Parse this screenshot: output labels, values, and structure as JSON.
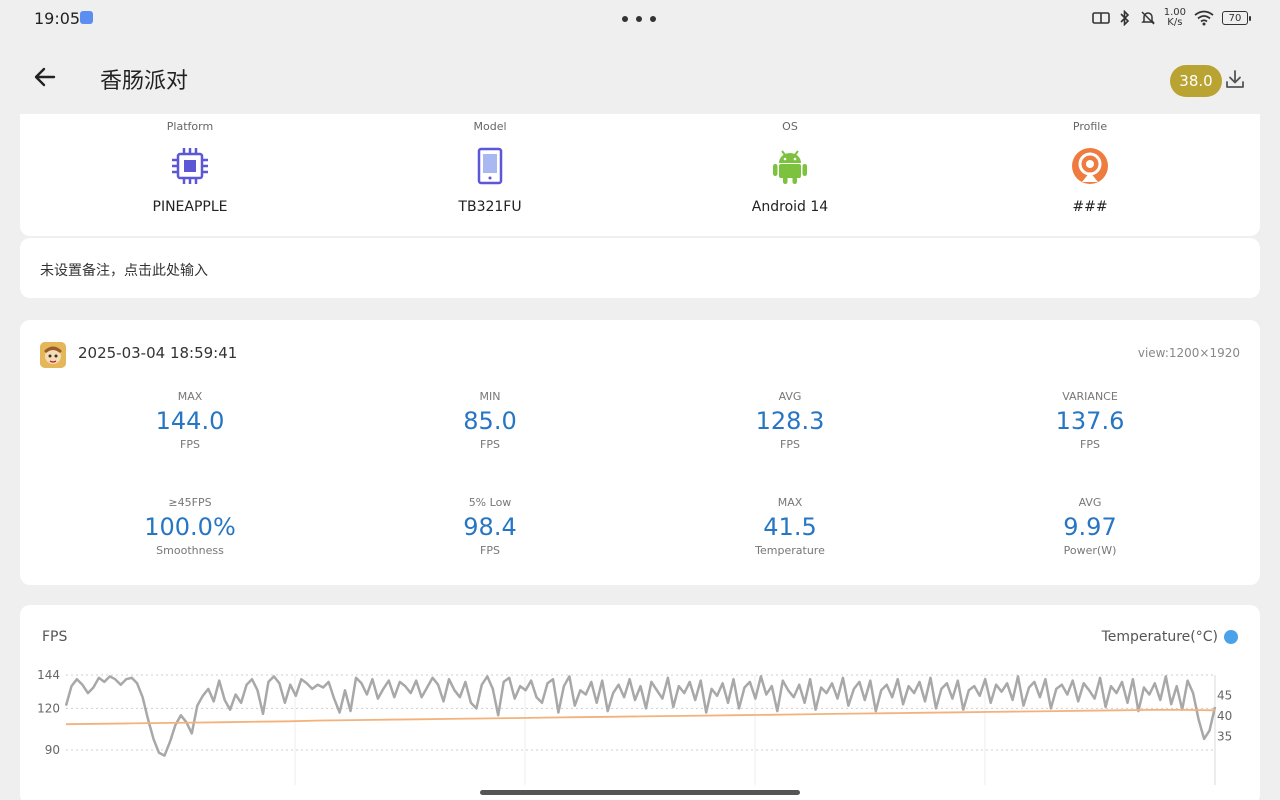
{
  "status_bar": {
    "time": "19:05",
    "net_speed_value": "1.00",
    "net_speed_unit": "K/s",
    "battery": "70"
  },
  "header": {
    "title": "香肠派对",
    "temp_badge": "38.0",
    "back_icon": "arrow-left-icon",
    "download_icon": "download-icon"
  },
  "device": [
    {
      "label": "Platform",
      "value": "PINEAPPLE",
      "icon": "chip-icon",
      "color": "#5b57d6"
    },
    {
      "label": "Model",
      "value": "TB321FU",
      "icon": "tablet-icon",
      "color": "#5b57d6"
    },
    {
      "label": "OS",
      "value": "Android 14",
      "icon": "android-icon",
      "color": "#7cc23f"
    },
    {
      "label": "Profile",
      "value": "###",
      "icon": "profile-icon",
      "color": "#f07b3f"
    }
  ],
  "note": {
    "placeholder": "未设置备注，点击此处输入"
  },
  "session": {
    "timestamp": "2025-03-04 18:59:41",
    "view": "view:1200×1920",
    "metrics": [
      {
        "label": "MAX",
        "value": "144.0",
        "unit": "FPS"
      },
      {
        "label": "MIN",
        "value": "85.0",
        "unit": "FPS"
      },
      {
        "label": "AVG",
        "value": "128.3",
        "unit": "FPS"
      },
      {
        "label": "VARIANCE",
        "value": "137.6",
        "unit": "FPS"
      },
      {
        "label": "≥45FPS",
        "value": "100.0%",
        "unit": "Smoothness"
      },
      {
        "label": "5% Low",
        "value": "98.4",
        "unit": "FPS"
      },
      {
        "label": "MAX",
        "value": "41.5",
        "unit": "Temperature"
      },
      {
        "label": "AVG",
        "value": "9.97",
        "unit": "Power(W)"
      }
    ]
  },
  "chart_data": {
    "type": "line",
    "title": "FPS",
    "legend": "Temperature(°C)",
    "left_ticks": [
      "144",
      "120",
      "90"
    ],
    "right_ticks": [
      "45",
      "40",
      "35"
    ],
    "ylim_left": [
      85,
      144
    ],
    "ylim_right": [
      30,
      50
    ],
    "series": [
      {
        "color": "#a8a8a8",
        "values": [
          122,
          136,
          141,
          137,
          131,
          135,
          142,
          139,
          143,
          141,
          137,
          141,
          142,
          138,
          128,
          112,
          98,
          88,
          86,
          96,
          108,
          115,
          110,
          102,
          122,
          129,
          134,
          125,
          140,
          126,
          119,
          130,
          124,
          137,
          141,
          133,
          116,
          139,
          143,
          138,
          124,
          137,
          129,
          141,
          138,
          134,
          137,
          135,
          139,
          127,
          117,
          133,
          118,
          142,
          138,
          130,
          141,
          127,
          134,
          140,
          128,
          139,
          136,
          131,
          140,
          128,
          135,
          142,
          137,
          125,
          141,
          133,
          128,
          139,
          124,
          120,
          137,
          143,
          134,
          115,
          139,
          142,
          127,
          136,
          133,
          140,
          128,
          124,
          138,
          141,
          117,
          136,
          143,
          122,
          133,
          130,
          139,
          124,
          140,
          118,
          131,
          137,
          128,
          141,
          126,
          136,
          120,
          139,
          133,
          127,
          142,
          121,
          136,
          131,
          139,
          126,
          140,
          117,
          134,
          129,
          138,
          124,
          141,
          120,
          135,
          139,
          127,
          143,
          130,
          136,
          118,
          140,
          133,
          128,
          137,
          124,
          141,
          119,
          135,
          131,
          138,
          127,
          142,
          122,
          134,
          139,
          126,
          140,
          118,
          133,
          137,
          128,
          141,
          123,
          136,
          131,
          139,
          125,
          142,
          120,
          134,
          138,
          127,
          140,
          119,
          133,
          136,
          129,
          141,
          124,
          137,
          132,
          138,
          126,
          143,
          122,
          135,
          139,
          128,
          141,
          120,
          134,
          137,
          130,
          140,
          125,
          138,
          133,
          127,
          142,
          121,
          136,
          131,
          139,
          124,
          141,
          118,
          135,
          130,
          138,
          126,
          143,
          123,
          136,
          119,
          140,
          131,
          112,
          98,
          104,
          121
        ]
      },
      {
        "color": "#f3b27c",
        "values": [
          38.0,
          38.1,
          38.2,
          38.3,
          38.4,
          38.5,
          38.6,
          38.7,
          38.9,
          39.0,
          39.1,
          39.2,
          39.3,
          39.4,
          39.5,
          39.6,
          39.7,
          39.8,
          39.9,
          40.0,
          40.1,
          40.2,
          40.3,
          40.4,
          40.5,
          40.6,
          40.7,
          40.8,
          40.9,
          41.0,
          41.1,
          41.2,
          41.3,
          41.4,
          41.5,
          41.5,
          41.4
        ]
      }
    ]
  }
}
